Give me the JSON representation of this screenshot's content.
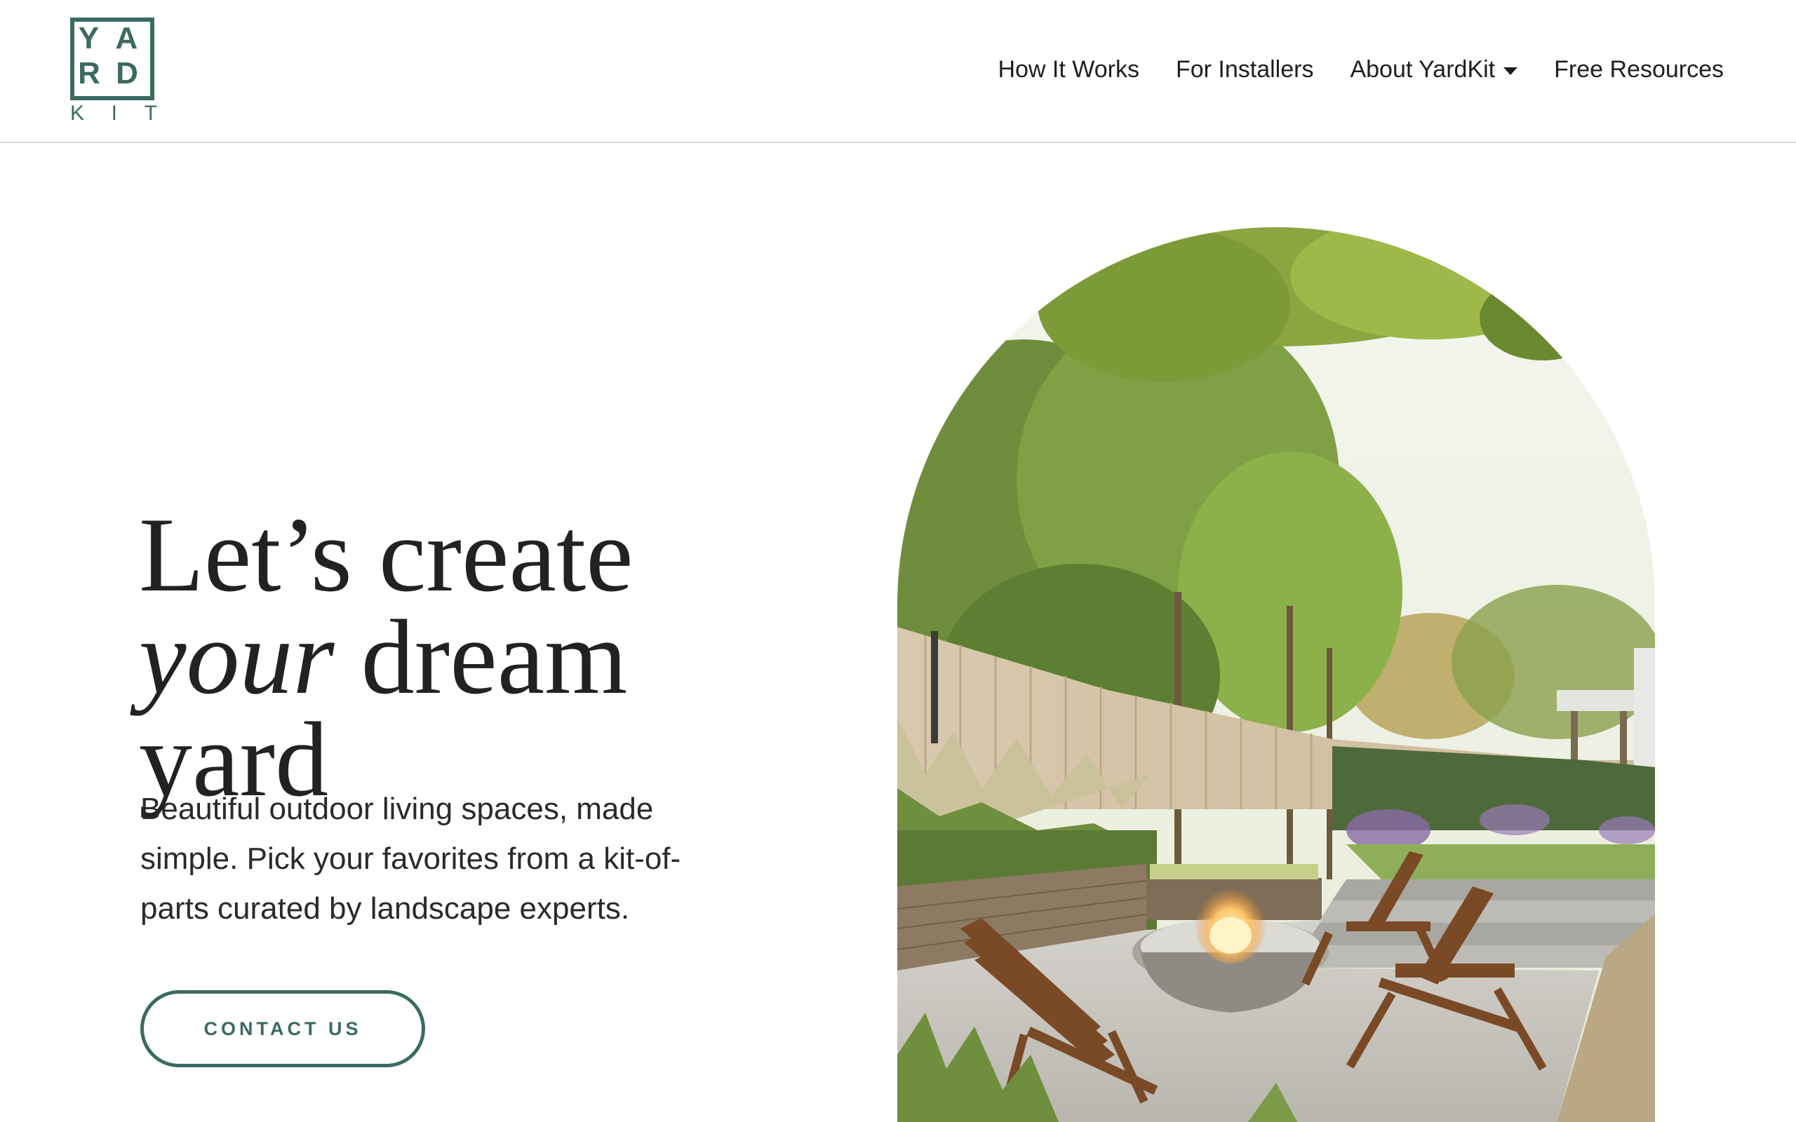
{
  "brand": {
    "logo_row1": [
      "Y",
      "A"
    ],
    "logo_row2": [
      "R",
      "D"
    ],
    "logo_row3": [
      "K",
      "I",
      "T"
    ],
    "color": "#3a6b63"
  },
  "nav": {
    "items": [
      {
        "label": "How It Works",
        "has_dropdown": false
      },
      {
        "label": "For Installers",
        "has_dropdown": false
      },
      {
        "label": "About YardKit",
        "has_dropdown": true
      },
      {
        "label": "Free Resources",
        "has_dropdown": false
      }
    ]
  },
  "hero": {
    "title_line1": "Let’s create",
    "title_italic": "your",
    "title_line2_rest": " dream",
    "title_line3": "yard",
    "subtitle": "Beautiful outdoor living spaces, made simple. Pick your favorites from a kit-of-parts curated by landscape experts.",
    "cta_label": "CONTACT US"
  },
  "image": {
    "icon": "backyard-firepit-image"
  }
}
